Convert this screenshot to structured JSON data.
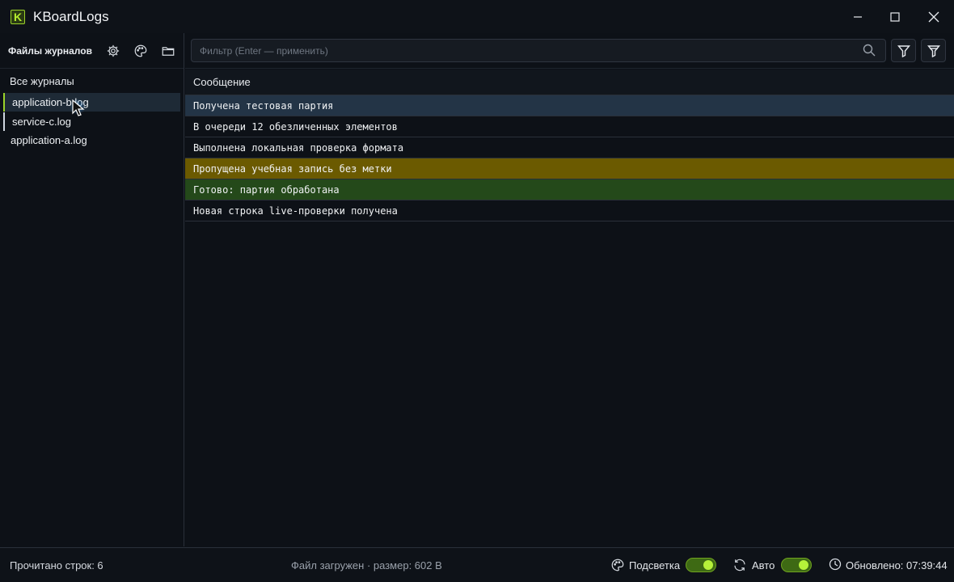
{
  "window": {
    "logo_letter": "K",
    "title": "KBoardLogs"
  },
  "sidebar": {
    "title": "Файлы журналов",
    "section_label": "Все журналы",
    "files": [
      {
        "label": "application-b.log"
      },
      {
        "label": "service-c.log"
      },
      {
        "label": "application-a.log"
      }
    ]
  },
  "filter": {
    "placeholder": "Фильтр (Enter — применить)",
    "value": ""
  },
  "table": {
    "column_header": "Сообщение",
    "rows": [
      {
        "text": "Получена тестовая партия"
      },
      {
        "text": "В очереди 12 обезличенных элементов"
      },
      {
        "text": "Выполнена локальная проверка формата"
      },
      {
        "text": "Пропущена учебная запись без метки"
      },
      {
        "text": "Готово: партия обработана"
      },
      {
        "text": "Новая строка live-проверки получена"
      }
    ]
  },
  "status": {
    "lines_read": "Прочитано строк: 6",
    "file_info": "Файл загружен · размер: 602 B",
    "highlight_label": "Подсветка",
    "highlight_on": true,
    "auto_label": "Авто",
    "auto_on": true,
    "updated": "Обновлено: 07:39:44"
  },
  "colors": {
    "accent": "#9bd32a",
    "selected_row": "#233446",
    "warning_row": "#6b5a00",
    "success_row": "#24491a"
  }
}
